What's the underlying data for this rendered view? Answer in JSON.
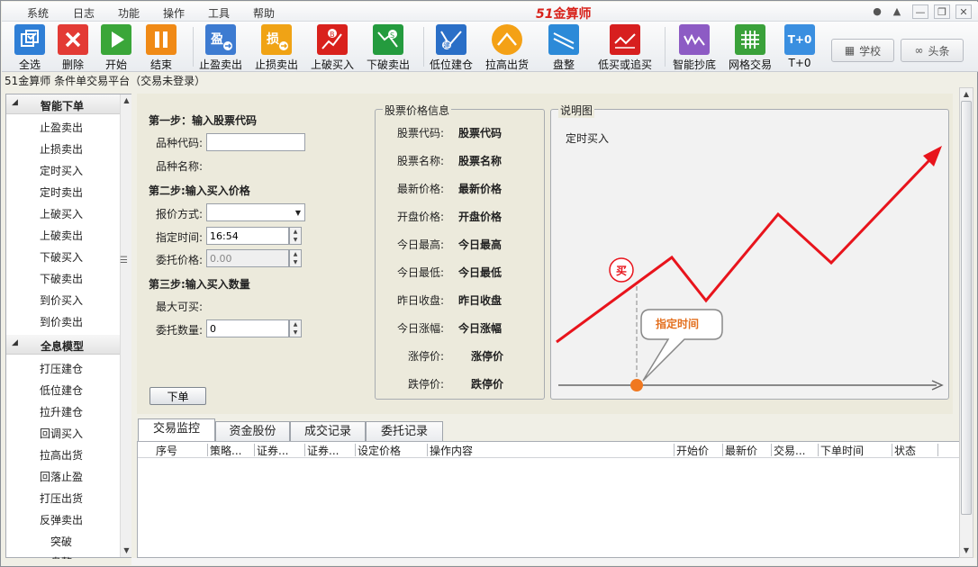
{
  "menu": {
    "items": [
      "系统",
      "日志",
      "功能",
      "操作",
      "工具",
      "帮助"
    ],
    "logo_num": "51",
    "logo_text": "金算师"
  },
  "toolbar": {
    "buttons": [
      {
        "label": "全选",
        "icon": "select-all-icon"
      },
      {
        "label": "删除",
        "icon": "delete-icon"
      },
      {
        "label": "开始",
        "icon": "play-icon"
      },
      {
        "label": "结束",
        "icon": "pause-icon"
      },
      {
        "label": "止盈卖出",
        "icon": "take-profit-icon"
      },
      {
        "label": "止损卖出",
        "icon": "stop-loss-icon"
      },
      {
        "label": "上破买入",
        "icon": "break-up-buy-icon"
      },
      {
        "label": "下破卖出",
        "icon": "break-down-sell-icon"
      },
      {
        "label": "低位建仓",
        "icon": "low-build-icon"
      },
      {
        "label": "拉高出货",
        "icon": "pull-high-icon"
      },
      {
        "label": "盘整",
        "icon": "consolidation-icon"
      },
      {
        "label": "低买或追买",
        "icon": "low-buy-chase-icon"
      },
      {
        "label": "智能抄底",
        "icon": "smart-bottom-icon"
      },
      {
        "label": "网格交易",
        "icon": "grid-trade-icon"
      },
      {
        "label": "T+0",
        "icon": "t0-icon",
        "icon_text": "T+0"
      }
    ],
    "school_label": "学校",
    "headline_label": "头条"
  },
  "title_line": "51金算师 条件单交易平台（交易未登录）",
  "sidebar": {
    "group1_title": "智能下单",
    "group1_items": [
      "止盈卖出",
      "止损卖出",
      "定时买入",
      "定时卖出",
      "上破买入",
      "上破卖出",
      "下破买入",
      "下破卖出",
      "到价买入",
      "到价卖出"
    ],
    "group2_title": "全息模型",
    "group2_items": [
      "打压建仓",
      "低位建仓",
      "拉升建仓",
      "回调买入",
      "拉高出货",
      "回落止盈",
      "打压出货",
      "反弹卖出"
    ],
    "extra_items": [
      "突破",
      "盘整"
    ]
  },
  "form": {
    "step1": "第一步：输入股票代码",
    "code_label": "品种代码:",
    "code_value": "",
    "name_label": "品种名称:",
    "step2": "第二步:输入买入价格",
    "quote_label": "报价方式:",
    "quote_value": "",
    "time_label": "指定时间:",
    "time_value": "16:54",
    "price_label": "委托价格:",
    "price_value": "0.00",
    "step3": "第三步:输入买入数量",
    "max_label": "最大可买:",
    "qty_label": "委托数量:",
    "qty_value": "0",
    "submit": "下单"
  },
  "price_info": {
    "title": "股票价格信息",
    "rows": [
      {
        "label": "股票代码:",
        "value": "股票代码"
      },
      {
        "label": "股票名称:",
        "value": "股票名称"
      },
      {
        "label": "最新价格:",
        "value": "最新价格"
      },
      {
        "label": "开盘价格:",
        "value": "开盘价格"
      },
      {
        "label": "今日最高:",
        "value": "今日最高"
      },
      {
        "label": "今日最低:",
        "value": "今日最低"
      },
      {
        "label": "昨日收盘:",
        "value": "昨日收盘"
      },
      {
        "label": "今日涨幅:",
        "value": "今日涨幅"
      },
      {
        "label": "涨停价:",
        "value": "涨停价"
      },
      {
        "label": "跌停价:",
        "value": "跌停价"
      }
    ]
  },
  "diagram": {
    "title": "说明图",
    "caption": "定时买入",
    "buy_mark": "买",
    "callout": "指定时间",
    "line_color": "#e8141c",
    "accent": "#f07820"
  },
  "tabs": [
    "交易监控",
    "资金股份",
    "成交记录",
    "委托记录"
  ],
  "grid_columns": [
    "序号",
    "策略...",
    "证券...",
    "证券...",
    "设定价格",
    "操作内容",
    "开始价",
    "最新价",
    "交易...",
    "下单时间",
    "状态"
  ]
}
